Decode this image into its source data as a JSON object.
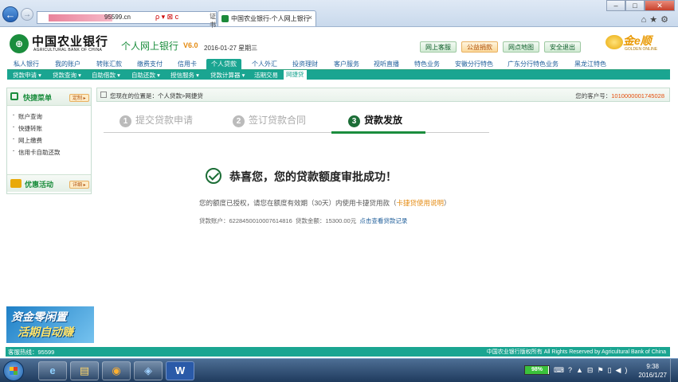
{
  "browser": {
    "address_url": "95599.cn",
    "address_controls": "ρ ▾ ⊠ c",
    "second_tab_label": "证书错误",
    "tab_title": "中国农业银行-个人网上银行",
    "tab_close": "×",
    "back_glyph": "←",
    "forward_glyph": "→",
    "window_controls": [
      "–",
      "□",
      "✕"
    ],
    "toolbar_icons": "⌂★⚙"
  },
  "header": {
    "logo_mark": "⊕",
    "bank_name_cn": "中国农业银行",
    "bank_name_en": "AGRICULTURAL BANK OF CHINA",
    "product": "个人网上银行",
    "version": "V6.0",
    "date": "2016-01-27 星期三",
    "buttons": [
      "网上客服",
      "公益捐款",
      "网点地图",
      "安全退出"
    ],
    "gold_logo": "金e顺",
    "gold_logo_sub": "GOLDEN ONLINE"
  },
  "main_nav": [
    "私人银行",
    "我的账户",
    "转账汇款",
    "缴费支付",
    "信用卡",
    "个人贷款",
    "个人外汇",
    "投资理财",
    "客户服务",
    "视听直播",
    "特色业务",
    "安徽分行特色",
    "广东分行特色业务",
    "黑龙江特色"
  ],
  "main_nav_active": "个人贷款",
  "sub_nav": [
    "贷款申请 ▾",
    "贷款查询 ▾",
    "自助借款 ▾",
    "自助还款 ▾",
    "授信服务 ▾",
    "贷款计算器 ▾",
    "活期交易",
    "网捷贷"
  ],
  "sub_nav_active": "网捷贷",
  "sidebar": {
    "quick_menu_title": "快捷菜单",
    "quick_menu_button": "定制 ▸",
    "quick_menu_items": [
      "账户查询",
      "快捷转账",
      "网上缴费",
      "信用卡自助还款"
    ],
    "promo_title": "优惠活动",
    "promo_button": "详细 ▸"
  },
  "location": {
    "text": "您现在的位置是：个人贷款>网捷贷",
    "customer_label": "您的客户号：",
    "customer_no": "1010000001745028"
  },
  "steps": [
    {
      "num": "1",
      "label": "提交贷款申请",
      "active": false
    },
    {
      "num": "2",
      "label": "签订贷款合同",
      "active": false
    },
    {
      "num": "3",
      "label": "贷款发放",
      "active": true
    }
  ],
  "result": {
    "title": "恭喜您，您的贷款额度审批成功！",
    "note": "您的额度已授权，请您在额度有效期（30天）内使用卡捷贷用款（",
    "note_link": "卡捷贷使用说明",
    "note_end": "）",
    "account_label": "贷款账户：",
    "account_no": "6228450010007614816",
    "amount_label": "贷款金额：",
    "amount": "15300.00元",
    "history_link": "点击查看贷款记录"
  },
  "ad": {
    "line1": "资金零闲置",
    "line2": "活期自动赚"
  },
  "footer": {
    "hotline_label": "客服热线：",
    "hotline": "95599",
    "copyright": "中国农业银行版权所有 All Rights Reserved by Agricultural Bank of China"
  },
  "taskbar": {
    "apps": [
      "e",
      "▤",
      "◉",
      "◈",
      "W"
    ],
    "battery": "98%",
    "battery_level": 0.98,
    "tray_icons": "⌨?▲⊟⚑▯◀)",
    "time": "9:38",
    "date": "2016/1/27"
  }
}
